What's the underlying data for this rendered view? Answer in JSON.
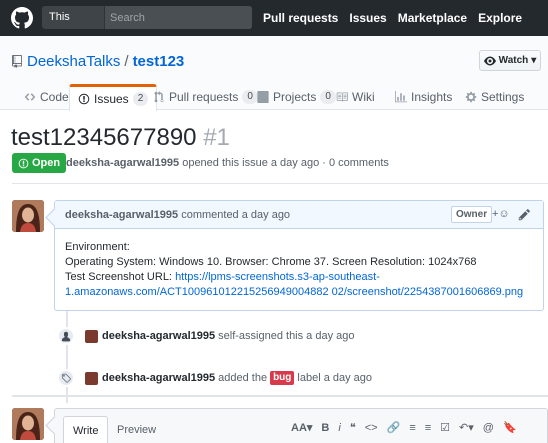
{
  "header": {
    "search_scope": "This repository",
    "search_placeholder": "Search",
    "nav": [
      "Pull requests",
      "Issues",
      "Marketplace",
      "Explore"
    ]
  },
  "repo": {
    "owner": "DeekshaTalks",
    "separator": "/",
    "name": "test123",
    "watch_label": "Watch",
    "tabs": [
      {
        "label": "Code",
        "icon": "code-icon"
      },
      {
        "label": "Issues",
        "count": "2",
        "icon": "issue-icon",
        "selected": true
      },
      {
        "label": "Pull requests",
        "count": "0",
        "icon": "pull-request-icon"
      },
      {
        "label": "Projects",
        "count": "0",
        "icon": "project-icon"
      },
      {
        "label": "Wiki",
        "icon": "book-icon"
      },
      {
        "label": "Insights",
        "icon": "graph-icon"
      },
      {
        "label": "Settings",
        "icon": "gear-icon"
      }
    ]
  },
  "issue": {
    "title": "test12345677890",
    "number": "#1",
    "state": "Open",
    "author": "deeksha-agarwal1995",
    "meta_text": "opened this issue a day ago · 0 comments"
  },
  "comment": {
    "author": "deeksha-agarwal1995",
    "time_text": "commented a day ago",
    "role": "Owner",
    "lines": {
      "l1": "Environment:",
      "l2": "Operating System: Windows 10. Browser: Chrome 37. Screen Resolution: 1024x768",
      "l3_label": "Test Screenshot URL: ",
      "l3_link": "https://lpms-screenshots.s3-ap-southeast-",
      "l4_link": "1.amazonaws.com/ACT100961012215256949004882 02/screenshot/2254387001606869.png"
    }
  },
  "events": [
    {
      "user": "deeksha-agarwal1995",
      "text": "self-assigned this a day ago"
    },
    {
      "user": "deeksha-agarwal1995",
      "pre": "added the",
      "label": "bug",
      "post": "label a day ago"
    }
  ],
  "editor": {
    "write_tab": "Write",
    "preview_tab": "Preview",
    "tools": [
      "AA▾",
      "B",
      "i",
      "❝",
      "<>",
      "🔗",
      "≡",
      "≡",
      "☑",
      "↶▾",
      "@",
      "🔖"
    ]
  },
  "colors": {
    "header_bg": "#24292e",
    "link": "#0366d6",
    "open_green": "#28a745",
    "bug_red": "#d73a4a",
    "tab_accent": "#e36209"
  }
}
